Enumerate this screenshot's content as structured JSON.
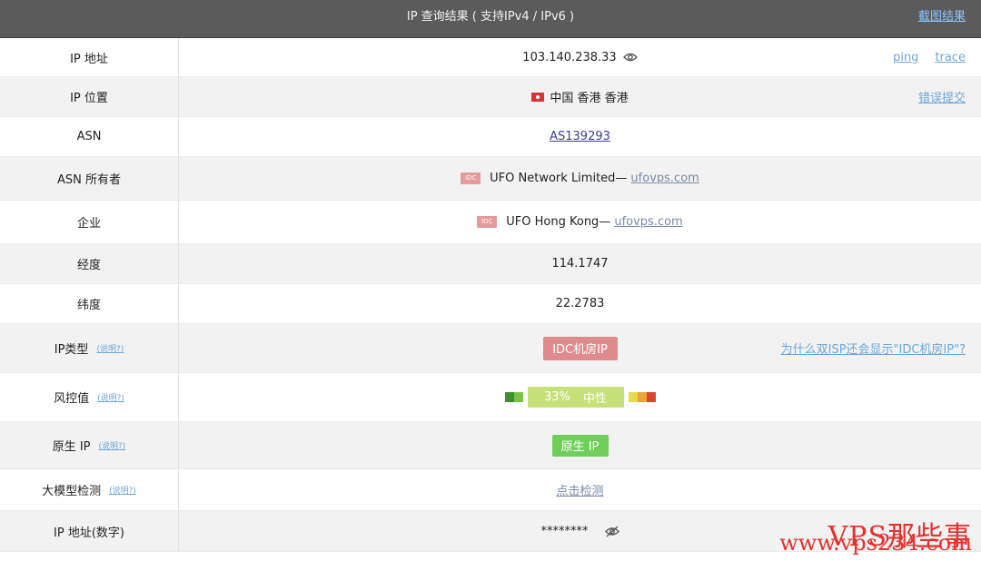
{
  "header": {
    "title": "IP 查询结果 ( 支持IPv4 / IPv6 )",
    "screenshot_label": "截图结果"
  },
  "rows": {
    "ip": {
      "label": "IP 地址",
      "value": "103.140.238.33",
      "ping": "ping",
      "trace": "trace"
    },
    "location": {
      "label": "IP 位置",
      "value": "中国 香港 香港",
      "report": "错误提交"
    },
    "asn": {
      "label": "ASN",
      "value": "AS139293"
    },
    "asn_owner": {
      "label": "ASN 所有者",
      "badge": "IDC",
      "name": "UFO Network Limited—",
      "domain": "ufovps.com"
    },
    "company": {
      "label": "企业",
      "badge": "IDC",
      "name": "UFO Hong Kong—",
      "domain": "ufovps.com"
    },
    "longitude": {
      "label": "经度",
      "value": "114.1747"
    },
    "latitude": {
      "label": "纬度",
      "value": "22.2783"
    },
    "ip_type": {
      "label": "IP类型",
      "help": "(说明?)",
      "value": "IDC机房IP",
      "question": "为什么双ISP还会显示\"IDC机房IP\"?"
    },
    "risk": {
      "label": "风控值",
      "help": "(说明?)",
      "percent": "33%",
      "level": "中性",
      "percent_value": 33
    },
    "native_ip": {
      "label": "原生 IP",
      "help": "(说明?)",
      "value": "原生 IP"
    },
    "llm_check": {
      "label": "大模型检测",
      "help": "(说明?)",
      "value": "点击检测"
    },
    "ip_numeric": {
      "label": "IP 地址(数字)",
      "value": "********"
    }
  },
  "watermark": {
    "line1": "VPS那些事",
    "line2": "www.vps234.com"
  },
  "icons": [
    "eye-icon",
    "eye-off-icon",
    "hk-flag-icon"
  ],
  "colors": {
    "header_bg": "#5b5b5b",
    "idc_badge": "#e59b9b",
    "idc_pill": "#e08b8b",
    "risk_pill": "#c6e07a",
    "native_pill": "#6fcf5a",
    "link": "#6fa6d8",
    "watermark": "#e6312e"
  }
}
